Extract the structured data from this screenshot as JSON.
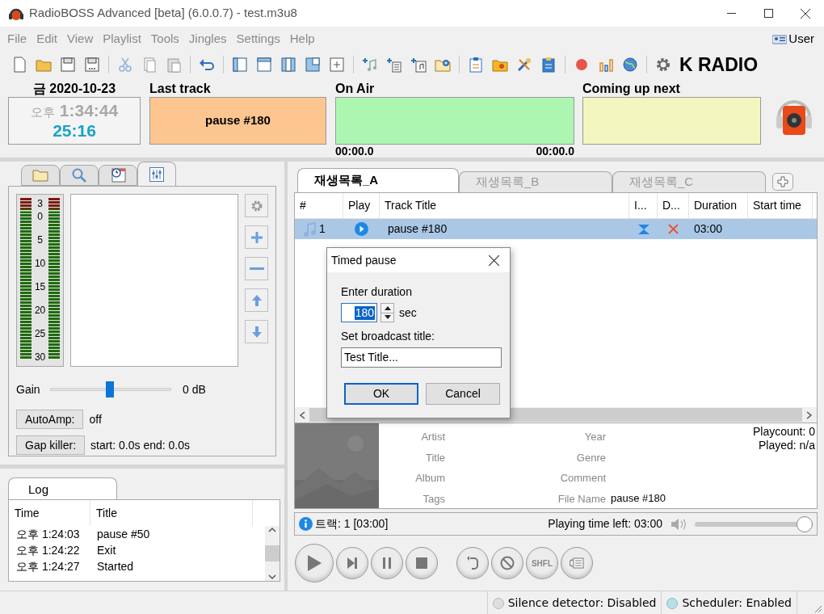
{
  "window": {
    "title": "RadioBOSS Advanced [beta] (6.0.0.7) - test.m3u8"
  },
  "menu": [
    "File",
    "Edit",
    "View",
    "Playlist",
    "Tools",
    "Jingles",
    "Settings",
    "Help"
  ],
  "user": "User",
  "logo_text": "K RADIO",
  "clock": {
    "date": "금 2020-10-23",
    "ampm": "오후",
    "time": "1:34:44",
    "countdown": "25:16"
  },
  "last_track": {
    "label": "Last track",
    "value": "pause #180"
  },
  "on_air": {
    "label": "On Air",
    "elapsed": "00:00.0",
    "remaining": "00:00.0"
  },
  "coming_up": {
    "label": "Coming up next"
  },
  "left_tabs": [
    {
      "kind": "folder",
      "selected": false
    },
    {
      "kind": "search",
      "selected": false
    },
    {
      "kind": "schedule",
      "selected": false
    },
    {
      "kind": "mixer",
      "selected": true
    }
  ],
  "meter": {
    "scale": [
      "3",
      "0",
      "5",
      "10",
      "15",
      "20",
      "25",
      "30"
    ]
  },
  "gain": {
    "label": "Gain",
    "level": 0.49,
    "reading": "0 dB"
  },
  "autoamp": {
    "button": "AutoAmp:",
    "value": "off"
  },
  "gap_killer": {
    "button": "Gap killer:",
    "value": "start: 0.0s end: 0.0s"
  },
  "log": {
    "tab": "Log",
    "columns": [
      "Time",
      "Title"
    ],
    "rows": [
      {
        "time": "오후 1:24:03",
        "title": "pause #50"
      },
      {
        "time": "오후 1:24:22",
        "title": "Exit"
      },
      {
        "time": "오후 1:24:27",
        "title": "Started"
      }
    ]
  },
  "playlist_tabs": [
    {
      "label": "재생목록_A",
      "selected": true
    },
    {
      "label": "재생목록_B",
      "selected": false
    },
    {
      "label": "재생목록_C",
      "selected": false
    }
  ],
  "table": {
    "columns": [
      "#",
      "Play",
      "Track Title",
      "I...",
      "D...",
      "Duration",
      "Start time"
    ],
    "rows": [
      {
        "number": "1",
        "title": "pause #180",
        "duration": "03:00",
        "selected": true
      }
    ]
  },
  "dialog": {
    "title": "Timed pause",
    "duration_label": "Enter duration",
    "duration_value": "180",
    "unit": "sec",
    "title_label": "Set broadcast title:",
    "title_value": "Test Title...",
    "buttons": [
      "OK",
      "Cancel"
    ]
  },
  "track_info": {
    "left_labels": [
      "Artist",
      "Title",
      "Album",
      "Tags"
    ],
    "right_labels": [
      "Year",
      "Genre",
      "Comment",
      "File Name"
    ],
    "file_name": "pause #180",
    "playcount": "Playcount: 0",
    "played": "Played: n/a"
  },
  "info_bar": {
    "tracks": "트랙: 1 [03:00]",
    "time_left": "Playing time left: 03:00",
    "volume": {
      "level": 0.97
    }
  },
  "transport": {
    "shuffle_label": "SHFL"
  },
  "status_bar": [
    {
      "text": "Silence detector: Disabled",
      "on": false
    },
    {
      "text": "Scheduler: Enabled",
      "on": true
    }
  ]
}
